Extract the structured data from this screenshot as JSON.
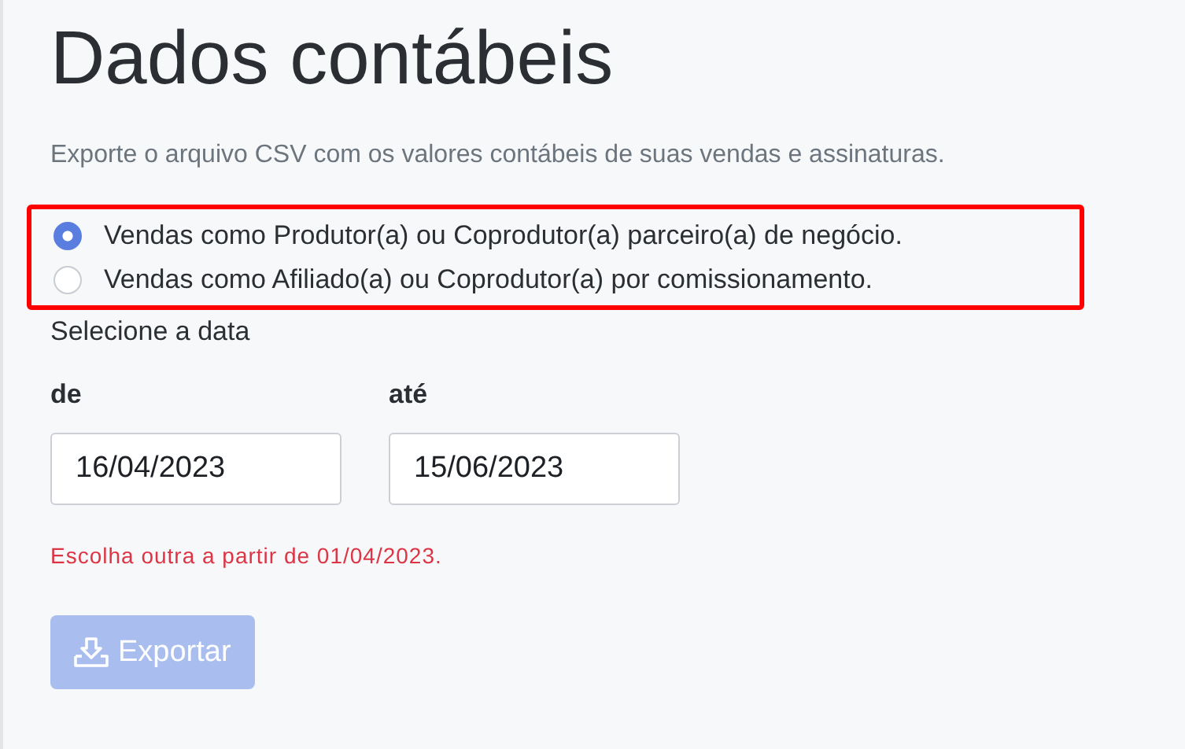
{
  "title": "Dados contábeis",
  "description": "Exporte o arquivo CSV com os valores contábeis de suas vendas e assinaturas.",
  "highlighted": true,
  "options": [
    {
      "label": "Vendas como Produtor(a) ou Coprodutor(a) parceiro(a) de negócio.",
      "selected": true
    },
    {
      "label": "Vendas como Afiliado(a) ou Coprodutor(a) por comissionamento.",
      "selected": false
    }
  ],
  "date_section": {
    "label": "Selecione a data",
    "fields": [
      {
        "label": "de",
        "value": "16/04/2023"
      },
      {
        "label": "até",
        "value": "15/06/2023"
      }
    ],
    "error": "Escolha outra a partir de 01/04/2023."
  },
  "export_button": {
    "label": "Exportar",
    "disabled": true
  }
}
